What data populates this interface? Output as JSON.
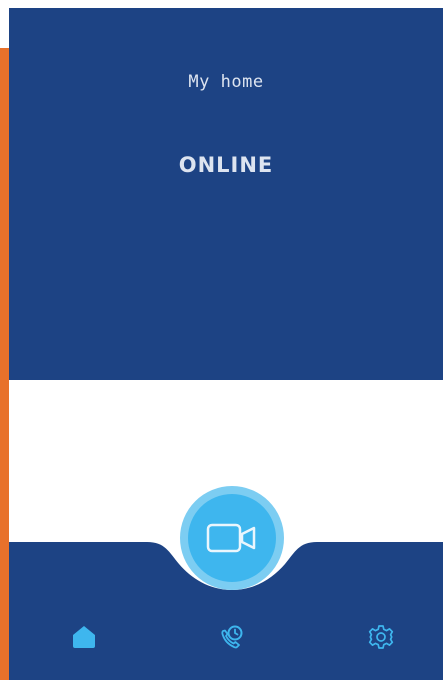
{
  "header": {
    "home_name": "My home",
    "status": "ONLINE"
  },
  "actions": {
    "primary": {
      "icon": "video-camera-icon"
    }
  },
  "bottom_nav": {
    "items": [
      {
        "id": "home",
        "icon": "home-icon",
        "active": true
      },
      {
        "id": "calls",
        "icon": "call-history-icon",
        "active": false
      },
      {
        "id": "settings",
        "icon": "gear-icon",
        "active": false
      }
    ]
  },
  "colors": {
    "primary": "#1d4384",
    "accent": "#3eb6ee",
    "accent_light": "#7ccdf2",
    "side_strip": "#e8712b",
    "text_on_primary": "#dde4f0",
    "background": "#ffffff"
  }
}
